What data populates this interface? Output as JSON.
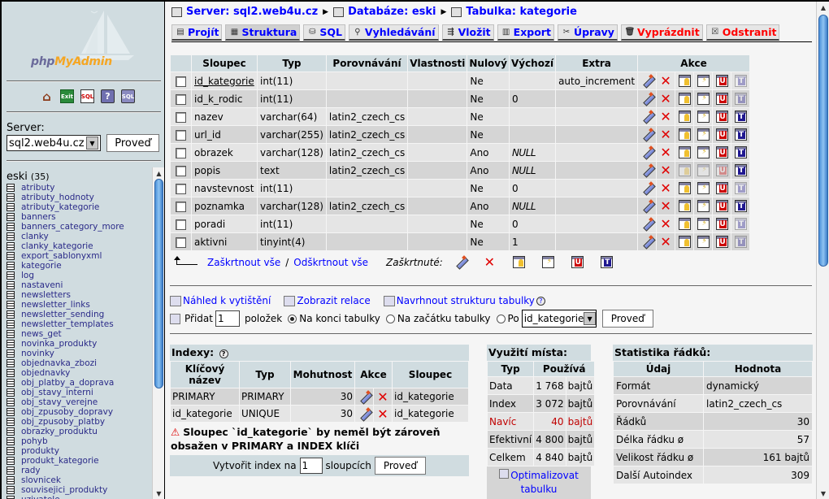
{
  "left": {
    "logo": {
      "php": "php",
      "my": "My",
      "admin": "Admin"
    },
    "quicknav": [
      {
        "name": "home-icon",
        "glyph": "⌂"
      },
      {
        "name": "exit-icon",
        "glyph": "Exit"
      },
      {
        "name": "sql-query-window-icon",
        "glyph": "SQL"
      },
      {
        "name": "help-icon",
        "glyph": "?"
      },
      {
        "name": "sql-docs-icon",
        "glyph": "SQL"
      }
    ],
    "server_label": "Server:",
    "server_value": "sql2.web4u.cz",
    "server_go": "Proveď",
    "database": "eski",
    "table_count": "(35)",
    "tables": [
      "atributy",
      "atributy_hodnoty",
      "atributy_kategorie",
      "banners",
      "banners_category_more",
      "clanky",
      "clanky_kategorie",
      "export_sablonyxml",
      "kategorie",
      "log",
      "nastaveni",
      "newsletters",
      "newsletter_links",
      "newsletter_sending",
      "newsletter_templates",
      "news_get",
      "novinka_produkty",
      "novinky",
      "objednavka_zbozi",
      "objednavky",
      "obj_platby_a_doprava",
      "obj_stavy_interni",
      "obj_stavy_verejne",
      "obj_zpusoby_dopravy",
      "obj_zpusoby_platby",
      "obrazky_produktu",
      "pohyb",
      "produkty",
      "produkt_kategorie",
      "rady",
      "slovnicek",
      "souvisejici_produkty",
      "uzivatele"
    ]
  },
  "breadcrumb": {
    "server": "Server: sql2.web4u.cz",
    "database": "Databáze: eski",
    "table": "Tabulka: kategorie"
  },
  "tabs": [
    {
      "label": "Projít",
      "icon": "browse-icon",
      "glyph": "▤",
      "active": false,
      "danger": false
    },
    {
      "label": "Struktura",
      "icon": "structure-icon",
      "glyph": "▦",
      "active": true,
      "danger": false
    },
    {
      "label": "SQL",
      "icon": "sql-icon",
      "glyph": "⛁",
      "active": false,
      "danger": false
    },
    {
      "label": "Vyhledávání",
      "icon": "search-icon",
      "glyph": "⚲",
      "active": false,
      "danger": false
    },
    {
      "label": "Vložit",
      "icon": "insert-icon",
      "glyph": "⇶",
      "active": false,
      "danger": false
    },
    {
      "label": "Export",
      "icon": "export-icon",
      "glyph": "▥",
      "active": false,
      "danger": false
    },
    {
      "label": "Úpravy",
      "icon": "operations-icon",
      "glyph": "✂",
      "active": false,
      "danger": false
    },
    {
      "label": "Vyprázdnit",
      "icon": "empty-icon",
      "glyph": "🗑",
      "active": false,
      "danger": true
    },
    {
      "label": "Odstranit",
      "icon": "drop-icon",
      "glyph": "☒",
      "active": false,
      "danger": true
    }
  ],
  "structure": {
    "headers": [
      "Sloupec",
      "Typ",
      "Porovnávání",
      "Vlastnosti",
      "Nulový",
      "Výchozí",
      "Extra",
      "Akce"
    ],
    "rows": [
      {
        "name": "id_kategorie",
        "type": "int(11)",
        "collation": "",
        "attributes": "",
        "null": "Ne",
        "default": "",
        "extra": "auto_increment",
        "primary_key": true,
        "actions": [
          1,
          1,
          1,
          1,
          1,
          0
        ]
      },
      {
        "name": "id_k_rodic",
        "type": "int(11)",
        "collation": "",
        "attributes": "",
        "null": "Ne",
        "default": "0",
        "extra": "",
        "primary_key": false,
        "actions": [
          1,
          1,
          1,
          1,
          1,
          0
        ]
      },
      {
        "name": "nazev",
        "type": "varchar(64)",
        "collation": "latin2_czech_cs",
        "attributes": "",
        "null": "Ne",
        "default": "",
        "extra": "",
        "primary_key": false,
        "actions": [
          1,
          1,
          1,
          1,
          1,
          1
        ]
      },
      {
        "name": "url_id",
        "type": "varchar(255)",
        "collation": "latin2_czech_cs",
        "attributes": "",
        "null": "Ne",
        "default": "",
        "extra": "",
        "primary_key": false,
        "actions": [
          1,
          1,
          1,
          1,
          1,
          1
        ]
      },
      {
        "name": "obrazek",
        "type": "varchar(128)",
        "collation": "latin2_czech_cs",
        "attributes": "",
        "null": "Ano",
        "default": "NULL",
        "extra": "",
        "primary_key": false,
        "actions": [
          1,
          1,
          1,
          1,
          1,
          1
        ]
      },
      {
        "name": "popis",
        "type": "text",
        "collation": "latin2_czech_cs",
        "attributes": "",
        "null": "Ano",
        "default": "NULL",
        "extra": "",
        "primary_key": false,
        "actions": [
          1,
          1,
          0,
          0,
          0,
          1
        ]
      },
      {
        "name": "navstevnost",
        "type": "int(11)",
        "collation": "",
        "attributes": "",
        "null": "Ne",
        "default": "0",
        "extra": "",
        "primary_key": false,
        "actions": [
          1,
          1,
          1,
          1,
          1,
          0
        ]
      },
      {
        "name": "poznamka",
        "type": "varchar(128)",
        "collation": "latin2_czech_cs",
        "attributes": "",
        "null": "Ano",
        "default": "NULL",
        "extra": "",
        "primary_key": false,
        "actions": [
          1,
          1,
          1,
          1,
          1,
          1
        ]
      },
      {
        "name": "poradi",
        "type": "int(11)",
        "collation": "",
        "attributes": "",
        "null": "Ne",
        "default": "0",
        "extra": "",
        "primary_key": false,
        "actions": [
          1,
          1,
          1,
          1,
          1,
          0
        ]
      },
      {
        "name": "aktivni",
        "type": "tinyint(4)",
        "collation": "",
        "attributes": "",
        "null": "Ne",
        "default": "1",
        "extra": "",
        "primary_key": false,
        "actions": [
          1,
          1,
          1,
          1,
          1,
          0
        ]
      }
    ],
    "action_icons": [
      "edit-icon",
      "drop-icon",
      "primary-key-icon",
      "index-icon",
      "unique-icon",
      "fulltext-icon"
    ]
  },
  "selection": {
    "check_all": "Zaškrtnout vše",
    "separator": "/",
    "uncheck_all": "Odškrtnout vše",
    "with_selected": "Zaškrtnuté:"
  },
  "links": {
    "print": "Náhled k vytištění",
    "relations": "Zobrazit relace",
    "propose": "Navrhnout strukturu tabulky"
  },
  "add_fields": {
    "label": "Přidat",
    "count": "1",
    "suffix": "položek",
    "at_end": "Na konci tabulky",
    "at_begin": "Na začátku tabulky",
    "after": "Po",
    "after_field": "id_kategorie",
    "selected": "at_end",
    "go": "Proveď"
  },
  "indexes": {
    "title": "Indexy:",
    "headers": [
      "Klíčový název",
      "Typ",
      "Mohutnost",
      "Akce",
      "Sloupec"
    ],
    "rows": [
      {
        "name": "PRIMARY",
        "type": "PRIMARY",
        "cardinality": "30",
        "column": "id_kategorie"
      },
      {
        "name": "id_kategorie",
        "type": "UNIQUE",
        "cardinality": "30",
        "column": "id_kategorie"
      }
    ],
    "warning": "Sloupec `id_kategorie` by neměl být zároveň obsažen v PRIMARY a INDEX klíči",
    "create_label": "Vytvořit index na",
    "create_count": "1",
    "create_suffix": "sloupcích",
    "create_go": "Proveď"
  },
  "space": {
    "title": "Využití místa:",
    "headers": [
      "Typ",
      "Používá"
    ],
    "rows": [
      {
        "type": "Data",
        "value": "1 768",
        "unit": "bajtů",
        "red": false
      },
      {
        "type": "Index",
        "value": "3 072",
        "unit": "bajtů",
        "red": false
      },
      {
        "type": "Navíc",
        "value": "40",
        "unit": "bajtů",
        "red": true
      },
      {
        "type": "Efektivní",
        "value": "4 800",
        "unit": "bajtů",
        "red": false
      },
      {
        "type": "Celkem",
        "value": "4 840",
        "unit": "bajtů",
        "red": false
      }
    ],
    "optimize": "Optimalizovat tabulku"
  },
  "stats": {
    "title": "Statistika řádků:",
    "headers": [
      "Údaj",
      "Hodnota"
    ],
    "rows": [
      {
        "label": "Formát",
        "value": "dynamický",
        "align": "left"
      },
      {
        "label": "Porovnávání",
        "value": "latin2_czech_cs",
        "align": "left"
      },
      {
        "label": "Řádků",
        "value": "30",
        "align": "right"
      },
      {
        "label": "Délka řádku ø",
        "value": "57",
        "align": "right"
      },
      {
        "label": "Velikost řádku ø",
        "value": "161 bajtů",
        "align": "right"
      },
      {
        "label": "Další Autoindex",
        "value": "309",
        "align": "right"
      }
    ]
  },
  "colors": {
    "link": "#0000ff",
    "danger": "#ff0000",
    "header_bg": "#d0dce0",
    "row_odd": "#e5e5e5",
    "row_even": "#d5d5d5",
    "left_bg": "#d0dce0"
  }
}
